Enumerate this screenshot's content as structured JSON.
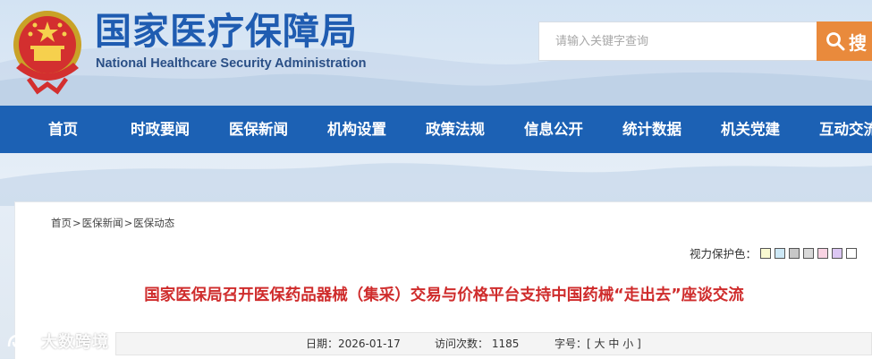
{
  "header": {
    "title": "国家医疗保障局",
    "subtitle": "National Healthcare Security Administration",
    "search_placeholder": "请输入关键字查询",
    "search_button": "搜"
  },
  "nav": {
    "items": [
      "首页",
      "时政要闻",
      "医保新闻",
      "机构设置",
      "政策法规",
      "信息公开",
      "统计数据",
      "机关党建",
      "互动交流"
    ]
  },
  "breadcrumb": {
    "items": [
      "首页",
      "医保新闻",
      "医保动态"
    ],
    "separator": ">"
  },
  "vision": {
    "label": "视力保护色：",
    "colors": [
      "#fafad2",
      "#cde8f6",
      "#c7c7c7",
      "#d9d9d9",
      "#f9d3e3",
      "#dcc7f3",
      "#ffffff"
    ]
  },
  "article": {
    "title": "国家医保局召开医保药品器械（集采）交易与价格平台支持中国药械“走出去”座谈交流",
    "date_label": "日期：",
    "date": "2026-01-17",
    "views_label": "访问次数：",
    "views": "1185",
    "font_label": "字号：",
    "font_open": "[",
    "font_sizes": [
      "大",
      "中",
      "小"
    ],
    "font_close": "]"
  },
  "watermark": {
    "text": "大数跨境"
  },
  "colors": {
    "nav_bg": "#1c61b4",
    "title_red": "#cf2c2c",
    "brand_blue": "#1f5cb1",
    "search_orange": "#e98a3c"
  }
}
